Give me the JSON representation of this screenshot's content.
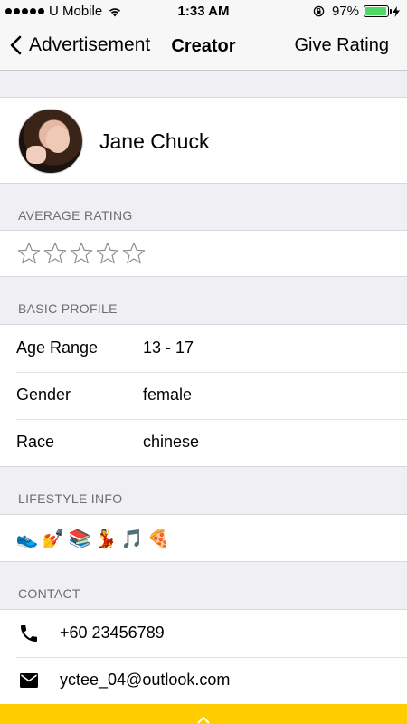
{
  "status_bar": {
    "carrier": "U Mobile",
    "time": "1:33 AM",
    "battery": "97%",
    "battery_level": 0.97,
    "icons": [
      "signal-dots-icon",
      "wifi-icon",
      "rotation-lock-icon",
      "battery-icon",
      "charging-bolt-icon"
    ]
  },
  "nav": {
    "back_label": "Advertisement",
    "title": "Creator",
    "action_label": "Give Rating"
  },
  "profile": {
    "name": "Jane Chuck"
  },
  "sections": {
    "average_rating": "AVERAGE RATING",
    "basic_profile": "BASIC PROFILE",
    "lifestyle_info": "LIFESTYLE INFO",
    "contact": "CONTACT"
  },
  "rating": {
    "value": 0,
    "max": 5
  },
  "basic_profile": [
    {
      "label": "Age Range",
      "value": "13 - 17"
    },
    {
      "label": "Gender",
      "value": "female"
    },
    {
      "label": "Race",
      "value": "chinese"
    }
  ],
  "lifestyle": {
    "icons": [
      "sneaker-icon",
      "nail-polish-icon",
      "books-icon",
      "dancer-icon",
      "music-notes-icon",
      "pizza-icon"
    ],
    "glyphs": [
      "👟",
      "💅",
      "📚",
      "💃",
      "🎵",
      "🍕"
    ]
  },
  "contact": {
    "phone": "+60 23456789",
    "email": "yctee_04@outlook.com"
  },
  "colors": {
    "accent_bar": "#ffcc00",
    "battery": "#4cd964",
    "background": "#efeff4"
  }
}
